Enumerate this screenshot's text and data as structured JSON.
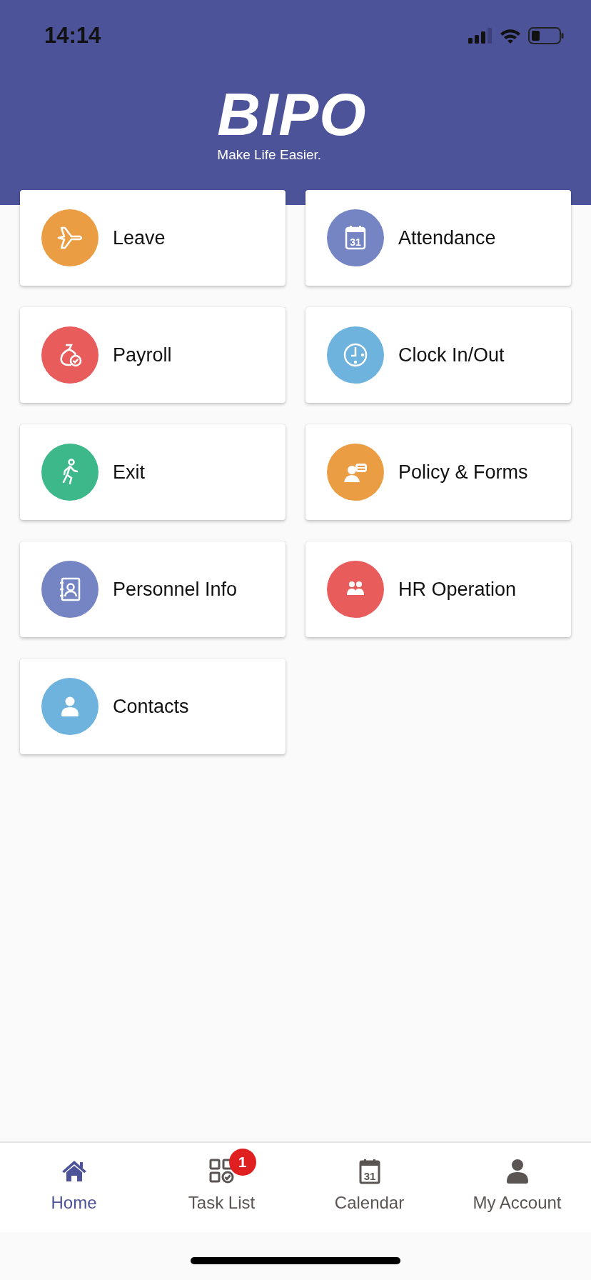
{
  "status_bar": {
    "time": "14:14"
  },
  "header": {
    "logo": "BIPO",
    "tagline": "Make Life Easier."
  },
  "modules": [
    {
      "label": "Leave",
      "color": "#eb9d44"
    },
    {
      "label": "Attendance",
      "color": "#7585c4",
      "icon_label": "31"
    },
    {
      "label": "Payroll",
      "color": "#e85c5c"
    },
    {
      "label": "Clock In/Out",
      "color": "#6db3de"
    },
    {
      "label": "Exit",
      "color": "#3db88b"
    },
    {
      "label": "Policy & Forms",
      "color": "#eb9d44"
    },
    {
      "label": "Personnel Info",
      "color": "#7585c4"
    },
    {
      "label": "HR Operation",
      "color": "#e85c5c"
    },
    {
      "label": "Contacts",
      "color": "#6db3de"
    }
  ],
  "tab_bar": [
    {
      "label": "Home",
      "selected": true
    },
    {
      "label": "Task List",
      "selected": false,
      "badge": "1"
    },
    {
      "label": "Calendar",
      "selected": false,
      "icon_label": "31"
    },
    {
      "label": "My Account",
      "selected": false
    }
  ]
}
